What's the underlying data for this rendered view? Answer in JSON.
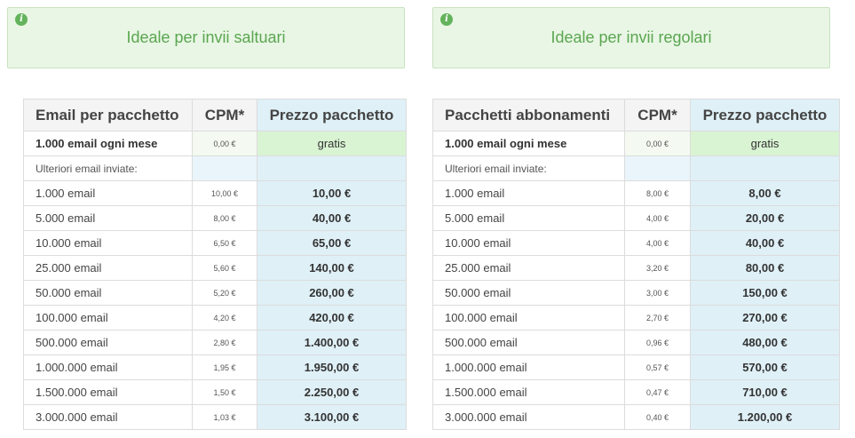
{
  "boxes": {
    "left": {
      "icon": "info-icon",
      "text": "Ideale per invii saltuari"
    },
    "right": {
      "icon": "info-icon",
      "text": "Ideale per invii regolari"
    }
  },
  "colors": {
    "info_bg": "#e9f6e5",
    "info_text": "#5aa650",
    "price_col_bg": "#dff0f7",
    "free_bg": "#d9f4d3"
  },
  "tables": [
    {
      "headers": [
        "Email per pacchetto",
        "CPM*",
        "Prezzo pacchetto"
      ],
      "free_row": [
        "1.000 email ogni mese",
        "0,00 €",
        "gratis"
      ],
      "sub_label": "Ulteriori email inviate:",
      "rows": [
        [
          "1.000 email",
          "10,00 €",
          "10,00 €"
        ],
        [
          "5.000 email",
          "8,00 €",
          "40,00 €"
        ],
        [
          "10.000 email",
          "6,50 €",
          "65,00 €"
        ],
        [
          "25.000 email",
          "5,60 €",
          "140,00 €"
        ],
        [
          "50.000 email",
          "5,20 €",
          "260,00 €"
        ],
        [
          "100.000 email",
          "4,20 €",
          "420,00 €"
        ],
        [
          "500.000 email",
          "2,80 €",
          "1.400,00 €"
        ],
        [
          "1.000.000 email",
          "1,95 €",
          "1.950,00 €"
        ],
        [
          "1.500.000 email",
          "1,50 €",
          "2.250,00 €"
        ],
        [
          "3.000.000 email",
          "1,03 €",
          "3.100,00 €"
        ]
      ]
    },
    {
      "headers": [
        "Pacchetti abbonamenti",
        "CPM*",
        "Prezzo pacchetto"
      ],
      "free_row": [
        "1.000 email ogni mese",
        "0,00 €",
        "gratis"
      ],
      "sub_label": "Ulteriori email inviate:",
      "rows": [
        [
          "1.000 email",
          "8,00 €",
          "8,00 €"
        ],
        [
          "5.000 email",
          "4,00 €",
          "20,00 €"
        ],
        [
          "10.000 email",
          "4,00 €",
          "40,00 €"
        ],
        [
          "25.000 email",
          "3,20 €",
          "80,00 €"
        ],
        [
          "50.000 email",
          "3,00 €",
          "150,00 €"
        ],
        [
          "100.000 email",
          "2,70 €",
          "270,00 €"
        ],
        [
          "500.000 email",
          "0,96 €",
          "480,00 €"
        ],
        [
          "1.000.000 email",
          "0,57 €",
          "570,00 €"
        ],
        [
          "1.500.000 email",
          "0,47 €",
          "710,00 €"
        ],
        [
          "3.000.000 email",
          "0,40 €",
          "1.200,00 €"
        ]
      ]
    }
  ]
}
